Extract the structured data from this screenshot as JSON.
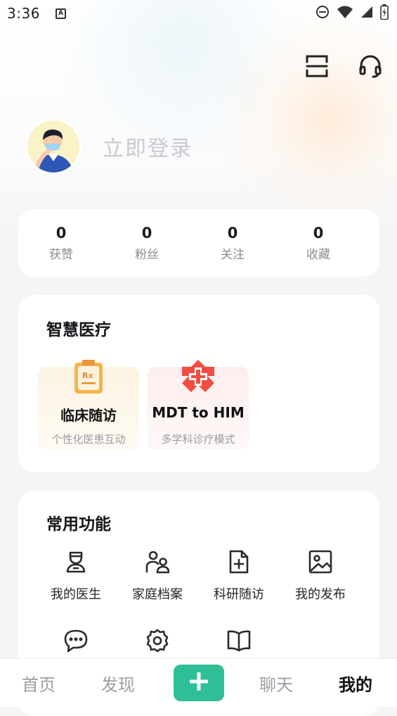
{
  "status_bar": {
    "time": "3:36",
    "notification_glyph": "A",
    "icons": [
      "dnd-icon",
      "wifi-icon",
      "signal-icon",
      "battery-icon"
    ]
  },
  "header": {
    "actions": [
      "scan-icon",
      "headset-icon"
    ]
  },
  "profile": {
    "login_label": "立即登录"
  },
  "stats": [
    {
      "value": "0",
      "label": "获赞"
    },
    {
      "value": "0",
      "label": "粉丝"
    },
    {
      "value": "0",
      "label": "关注"
    },
    {
      "value": "0",
      "label": "收藏"
    }
  ],
  "smart_medical": {
    "title": "智慧医疗",
    "tiles": [
      {
        "title": "临床随访",
        "subtitle": "个性化医患互动",
        "icon": "prescription-clipboard-icon"
      },
      {
        "title": "MDT to HIM",
        "subtitle": "多学科诊疗模式",
        "icon": "medical-cross-icon"
      }
    ]
  },
  "common_functions": {
    "title": "常用功能",
    "items": [
      {
        "label": "我的医生",
        "icon": "doctor-icon"
      },
      {
        "label": "家庭档案",
        "icon": "family-icon"
      },
      {
        "label": "科研随访",
        "icon": "document-add-icon"
      },
      {
        "label": "我的发布",
        "icon": "image-icon"
      },
      {
        "label": "",
        "icon": "chat-bubble-icon"
      },
      {
        "label": "",
        "icon": "settings-icon"
      },
      {
        "label": "",
        "icon": "book-icon"
      }
    ]
  },
  "tabbar": {
    "tabs": [
      "首页",
      "发现",
      "聊天",
      "我的"
    ],
    "active": "我的"
  },
  "colors": {
    "accent": "#2fbf97",
    "tile_orange": "#f2a23a",
    "tile_red": "#f04e43",
    "muted_text": "#8c8c94"
  }
}
